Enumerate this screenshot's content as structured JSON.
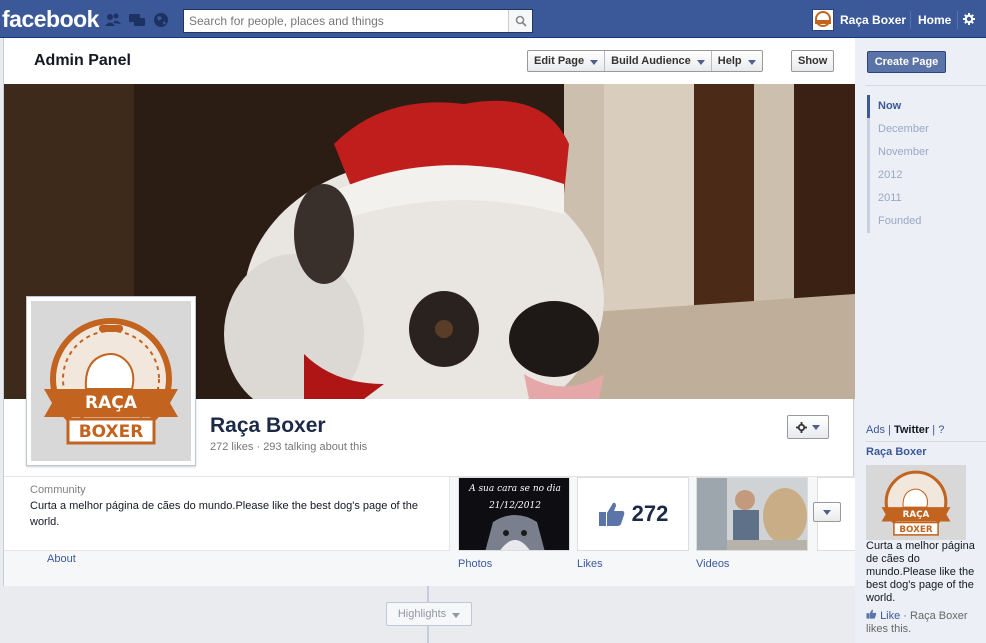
{
  "topbar": {
    "logo": "facebook",
    "search_placeholder": "Search for people, places and things",
    "user_name": "Raça Boxer",
    "home_label": "Home"
  },
  "admin": {
    "title": "Admin Panel",
    "edit_page": "Edit Page",
    "build_audience": "Build Audience",
    "help": "Help",
    "show": "Show"
  },
  "page": {
    "name": "Raça Boxer",
    "stats": "272 likes · 293 talking about this",
    "logo_top": "RAÇA",
    "logo_bottom": "BOXER",
    "category": "Community",
    "description": "Curta a melhor página de cães do mundo.Please like the best dog's page of the world.",
    "about_label": "About"
  },
  "apps": {
    "photos_label": "Photos",
    "photos_caption_1": "A sua cara se no dia",
    "photos_caption_2": "21/12/2012",
    "likes_label": "Likes",
    "likes_count": "272",
    "videos_label": "Videos"
  },
  "timeline": {
    "highlights_label": "Highlights",
    "scrubber": [
      "Now",
      "December",
      "November",
      "2012",
      "2011",
      "Founded"
    ]
  },
  "sidebar": {
    "create_page": "Create Page",
    "ads_label": "Ads",
    "sep": "|",
    "twitter_label": "Twitter",
    "question": "?",
    "ad_title": "Raça Boxer",
    "ad_text": "Curta a melhor página de cães do mundo.Please like the best dog's page of the world.",
    "ad_like": "Like",
    "ad_like_suffix": " · Raça Boxer likes this."
  },
  "colors": {
    "brand_blue": "#3b5998",
    "logo_orange": "#c2641f"
  }
}
